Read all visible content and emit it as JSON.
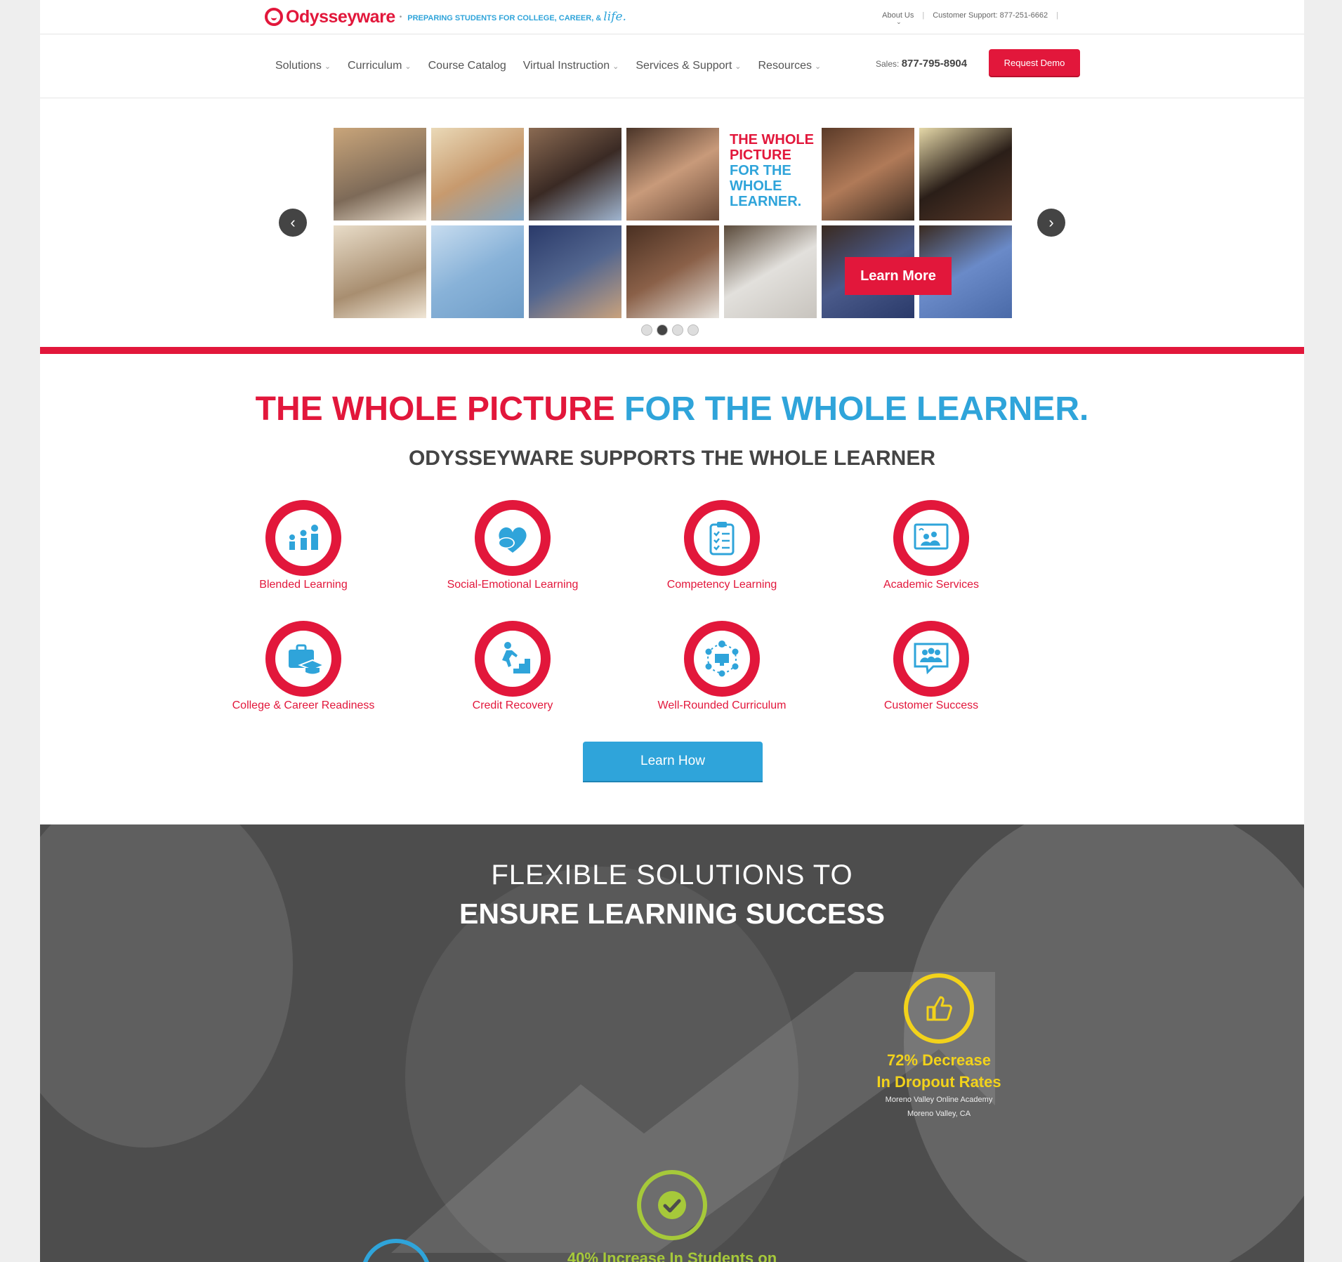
{
  "brand": {
    "name": "Odysseyware",
    "tagline": "PREPARING STUDENTS FOR COLLEGE, CAREER, &",
    "tagline_italic": "life."
  },
  "toplinks": {
    "about": "About Us",
    "support_label": "Customer Support:",
    "support_phone": "877-251-6662"
  },
  "nav": {
    "items": [
      {
        "label": "Solutions",
        "dropdown": true
      },
      {
        "label": "Curriculum",
        "dropdown": true
      },
      {
        "label": "Course Catalog",
        "dropdown": false
      },
      {
        "label": "Virtual Instruction",
        "dropdown": true
      },
      {
        "label": "Services & Support",
        "dropdown": true
      },
      {
        "label": "Resources",
        "dropdown": true
      }
    ],
    "sales_label": "Sales:",
    "sales_phone": "877-795-8904",
    "demo_button": "Request Demo"
  },
  "hero": {
    "text_red": "THE WHOLE PICTURE",
    "text_blue": "FOR THE WHOLE LEARNER.",
    "cta": "Learn More",
    "slide_count": 4,
    "active_slide": 2
  },
  "section": {
    "headline_red": "THE WHOLE PICTURE",
    "headline_blue": "FOR THE WHOLE LEARNER.",
    "subhead": "ODYSSEYWARE SUPPORTS THE WHOLE LEARNER",
    "features": [
      {
        "label": "Blended Learning",
        "icon": "bar-people-icon"
      },
      {
        "label": "Social-Emotional Learning",
        "icon": "speech-heart-icon"
      },
      {
        "label": "Competency Learning",
        "icon": "clipboard-checklist-icon"
      },
      {
        "label": "Academic Services",
        "icon": "presentation-icon"
      },
      {
        "label": "College & Career Readiness",
        "icon": "briefcase-cap-icon"
      },
      {
        "label": "Credit Recovery",
        "icon": "stairs-climber-icon"
      },
      {
        "label": "Well-Rounded Curriculum",
        "icon": "network-monitor-icon"
      },
      {
        "label": "Customer Success",
        "icon": "group-chat-icon"
      }
    ],
    "cta": "Learn How"
  },
  "solutions": {
    "title_light": "FLEXIBLE SOLUTIONS TO",
    "title_bold": "ENSURE LEARNING SUCCESS",
    "stats": [
      {
        "title_line1": "72% Decrease",
        "title_line2": "In Dropout Rates",
        "sub1": "Moreno Valley Online Academy",
        "sub2": "Moreno Valley, CA",
        "color": "#f2d21b",
        "icon": "thumbs-up-icon"
      },
      {
        "title_line1": "40% Increase In Students on",
        "color": "#a6c93a",
        "icon": "checkmark-icon"
      }
    ]
  },
  "colors": {
    "brand_red": "#e2173b",
    "brand_blue": "#2fa4da",
    "stat_yellow": "#f2d21b",
    "stat_green": "#a6c93a"
  }
}
